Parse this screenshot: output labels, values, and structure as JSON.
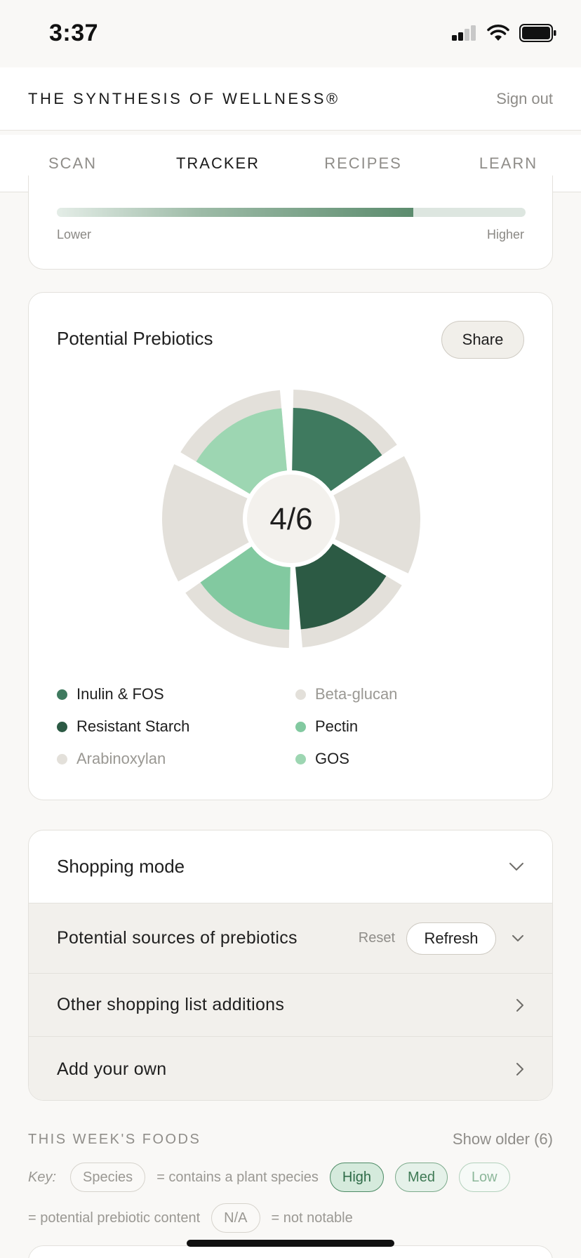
{
  "status_bar": {
    "time": "3:37"
  },
  "header": {
    "brand": "THE SYNTHESIS OF WELLNESS®",
    "signout": "Sign out"
  },
  "tabs": [
    {
      "label": "SCAN",
      "active": false
    },
    {
      "label": "TRACKER",
      "active": true
    },
    {
      "label": "RECIPES",
      "active": false
    },
    {
      "label": "LEARN",
      "active": false
    }
  ],
  "spectrum": {
    "lower": "Lower",
    "higher": "Higher",
    "level_percent": 76
  },
  "prebiotics": {
    "title": "Potential Prebiotics",
    "share": "Share",
    "score": "4/6",
    "segments": [
      {
        "name": "Inulin & FOS",
        "present": true,
        "color": "#3f7a5f"
      },
      {
        "name": "Beta-glucan",
        "present": false,
        "color": "#e3e0da"
      },
      {
        "name": "Resistant Starch",
        "present": true,
        "color": "#2c5a44"
      },
      {
        "name": "Pectin",
        "present": true,
        "color": "#82c9a0"
      },
      {
        "name": "Arabinoxylan",
        "present": false,
        "color": "#e3e0da"
      },
      {
        "name": "GOS",
        "present": true,
        "color": "#9dd6b2"
      }
    ],
    "legend_order": [
      "Inulin & FOS",
      "Beta-glucan",
      "Resistant Starch",
      "Pectin",
      "Arabinoxylan",
      "GOS"
    ]
  },
  "shopping": {
    "title": "Shopping mode",
    "rows": [
      {
        "label": "Potential sources of prebiotics",
        "reset": "Reset",
        "refresh": "Refresh"
      },
      {
        "label": "Other shopping list additions"
      },
      {
        "label": "Add your own"
      }
    ]
  },
  "week": {
    "title": "THIS WEEK'S FOODS",
    "show_older": "Show older (6)",
    "key": {
      "label": "Key:",
      "species_pill": "Species",
      "species_text": "= contains a plant species",
      "high": "High",
      "med": "Med",
      "low": "Low",
      "prebiotic_text": "= potential prebiotic content",
      "na": "N/A",
      "na_text": "= not notable"
    }
  }
}
